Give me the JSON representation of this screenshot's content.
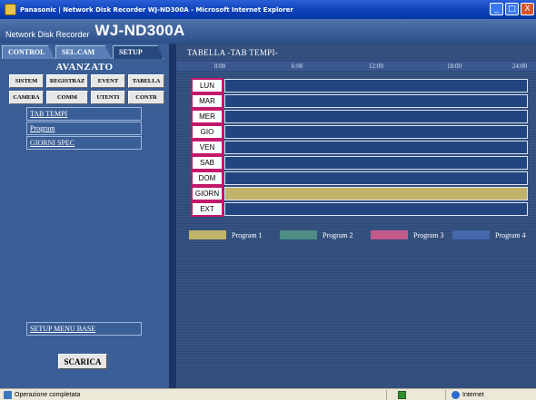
{
  "window": {
    "title": "Panasonic | Network Disk Recorder WJ-ND300A - Microsoft Internet Explorer",
    "buttons": [
      "_",
      "□",
      "X"
    ]
  },
  "header": {
    "subtitle": "Network Disk Recorder",
    "model": "WJ-ND300A"
  },
  "left": {
    "tabs": [
      {
        "label": "CONTROL"
      },
      {
        "label": "SEL.CAM"
      },
      {
        "label": "SETUP"
      }
    ],
    "section_title": "AVANZATO",
    "buttons_row1": [
      "SISTEM",
      "REGISTRAZ",
      "EVENT",
      "TABELLA"
    ],
    "buttons_row2": [
      "CAMERA",
      "COMM",
      "UTENTI",
      "CONTR"
    ],
    "menu": [
      "TAB TEMPI",
      "Program",
      "GIORNI SPEC"
    ],
    "base_menu": "SETUP MENU BASE",
    "download": "SCARICA"
  },
  "right": {
    "title": "TABELLA -TAB TEMPI-",
    "hours": [
      "0:00",
      "6:00",
      "12:00",
      "18:00",
      "24:00"
    ],
    "days": [
      {
        "label": "LUN",
        "fill": 0
      },
      {
        "label": "MAR",
        "fill": 0
      },
      {
        "label": "MER",
        "fill": 0
      },
      {
        "label": "GIO",
        "fill": 0
      },
      {
        "label": "VEN",
        "fill": 0
      },
      {
        "label": "SAB",
        "fill": 0
      },
      {
        "label": "DOM",
        "fill": 0
      },
      {
        "label": "GIORN",
        "fill": 1
      },
      {
        "label": "EXT",
        "fill": 0
      }
    ],
    "legend": [
      {
        "label": "Program 1",
        "color": "#c2b36a"
      },
      {
        "label": "Program 2",
        "color": "#4c8e86"
      },
      {
        "label": "Program 3",
        "color": "#c25a8c"
      },
      {
        "label": "Program 4",
        "color": "#4468ad"
      }
    ]
  },
  "status": {
    "text": "Operazione completata",
    "zone": "Internet"
  }
}
